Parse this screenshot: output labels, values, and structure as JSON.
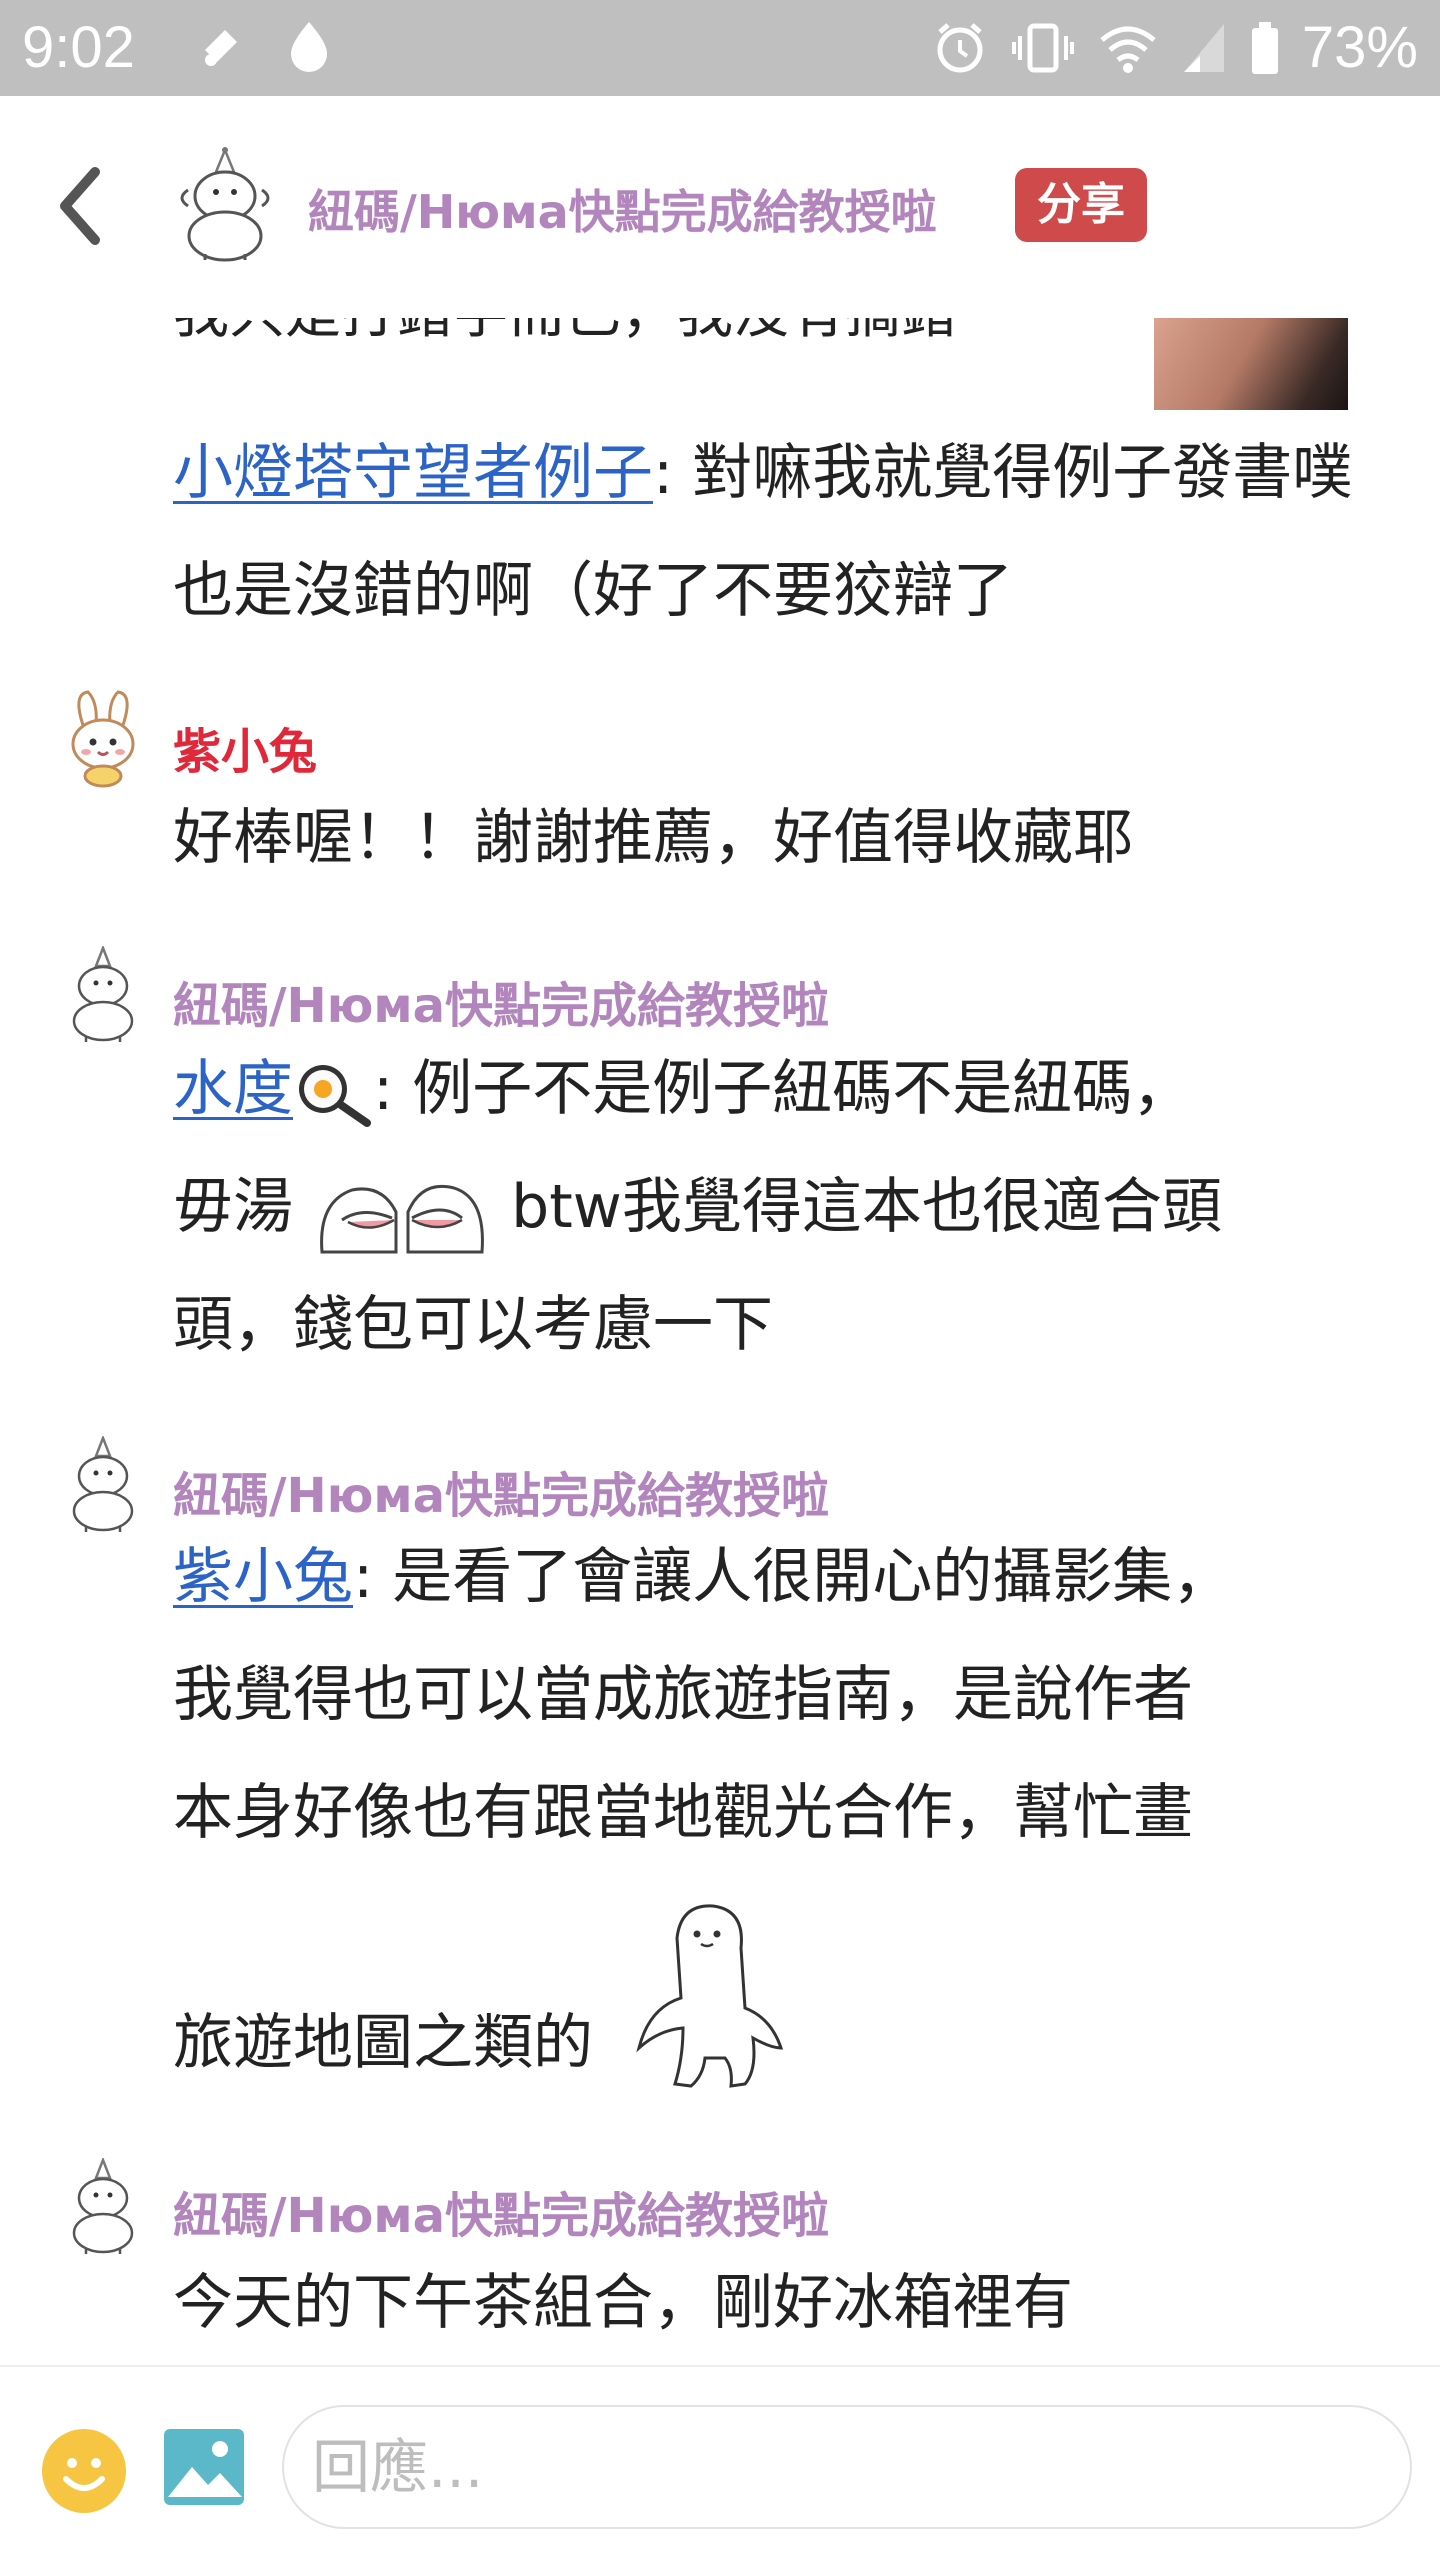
{
  "status_bar": {
    "time": "9:02",
    "battery_text": "73%",
    "icons": [
      "notification-icon",
      "location-icon",
      "alarm-icon",
      "vibrate-icon",
      "wifi-icon",
      "signal-icon",
      "battery-icon"
    ]
  },
  "header": {
    "title": "紐碼/Нюма快點完成給教授啦",
    "share_label": "分享",
    "title_color": "#b286bd",
    "share_color": "#cf4a4a"
  },
  "thread": {
    "partial_line": "我只是打錯字而已，我沒有搞錯",
    "first_message": {
      "mention": "小燈塔守望者例子",
      "text": ": 對嘛我就覺得例子發書噗也是沒錯的啊（好了不要狡辯了"
    },
    "comments": [
      {
        "author": "紫小兔",
        "author_color": "#e0283a",
        "text": "好棒喔！！謝謝推薦，好值得收藏耶"
      },
      {
        "author": "紐碼/Нюма快點完成給教授啦",
        "author_color": "#b286bd",
        "mention": "水度",
        "line1_rest": ": 例子不是例子紐碼不是紐碼，",
        "line2_a": "毋湯",
        "line2_b": "btw我覺得這本也很適合頭",
        "line3": "頭，錢包可以考慮一下"
      },
      {
        "author": "紐碼/Нюма快點完成給教授啦",
        "author_color": "#b286bd",
        "mention": "紫小兔",
        "line1_rest": ": 是看了會讓人很開心的攝影集，",
        "line2": "我覺得也可以當成旅遊指南，是說作者",
        "line3": "本身好像也有跟當地觀光合作，幫忙畫",
        "line4": "旅遊地圖之類的"
      },
      {
        "author": "紐碼/Нюма快點完成給教授啦",
        "author_color": "#b286bd",
        "text": "今天的下午茶組合，剛好冰箱裡有"
      }
    ]
  },
  "reply_bar": {
    "placeholder": "回應..."
  }
}
